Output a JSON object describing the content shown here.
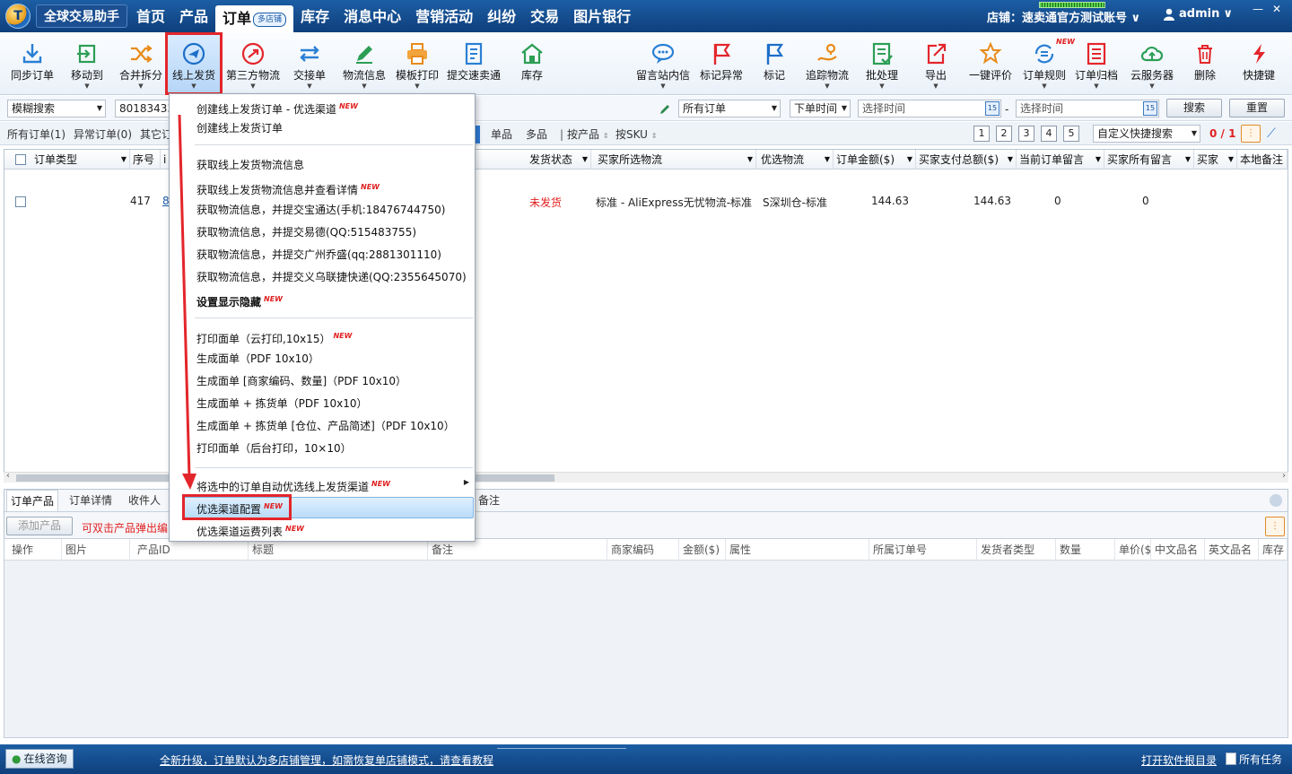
{
  "app": {
    "name": "全球交易助手"
  },
  "main_nav": [
    {
      "label": "首页"
    },
    {
      "label": "产品"
    },
    {
      "label": "订单",
      "badge": "多店铺"
    },
    {
      "label": "库存"
    },
    {
      "label": "消息中心"
    },
    {
      "label": "营销活动"
    },
    {
      "label": "纠纷"
    },
    {
      "label": "交易"
    },
    {
      "label": "图片银行"
    }
  ],
  "store": {
    "label": "店铺：速卖通官方测试账号"
  },
  "user": {
    "name": "admin"
  },
  "toolbar": {
    "items": [
      {
        "label": "同步订单",
        "icon": "download-icon"
      },
      {
        "label": "移动到",
        "icon": "move-icon"
      },
      {
        "label": "合并拆分",
        "icon": "shuffle-icon"
      },
      {
        "label": "线上发货",
        "icon": "plane-icon"
      },
      {
        "label": "第三方物流",
        "icon": "thirdparty-icon"
      },
      {
        "label": "交接单",
        "icon": "swap-icon"
      },
      {
        "label": "物流信息",
        "icon": "pen-icon"
      },
      {
        "label": "模板打印",
        "icon": "printer-icon"
      },
      {
        "label": "提交速卖通",
        "icon": "document-icon"
      },
      {
        "label": "库存",
        "icon": "warehouse-icon"
      },
      {
        "label": "留言站内信",
        "icon": "chat-icon"
      },
      {
        "label": "标记异常",
        "icon": "red-flag-icon"
      },
      {
        "label": "标记",
        "icon": "blue-flag-icon"
      },
      {
        "label": "追踪物流",
        "icon": "tracking-icon"
      },
      {
        "label": "批处理",
        "icon": "batch-icon"
      },
      {
        "label": "导出",
        "icon": "export-icon"
      },
      {
        "label": "一键评价",
        "icon": "review-icon"
      },
      {
        "label": "订单规则",
        "icon": "rules-icon",
        "new": "NEW"
      },
      {
        "label": "订单归档",
        "icon": "archive-icon"
      },
      {
        "label": "云服务器",
        "icon": "cloud-icon"
      },
      {
        "label": "删除",
        "icon": "trash-icon"
      },
      {
        "label": "快捷键",
        "icon": "lightning-icon"
      }
    ]
  },
  "filters": {
    "search_mode": "模糊搜索",
    "search_value": "80183433",
    "order_scope": "所有订单",
    "time_field": "下单时间",
    "start_placeholder": "选择时间",
    "dash": "-",
    "end_placeholder": "选择时间",
    "search_button": "搜索",
    "reset_button": "重置"
  },
  "order_tabs": {
    "all": "所有订单(1)",
    "exception": "异常订单(0)",
    "other": "其它订",
    "single": "单品",
    "multi": "多品",
    "by_product": "按产品",
    "by_sku": "按SKU",
    "pages": [
      "1",
      "2",
      "3",
      "4",
      "5"
    ],
    "quick_search": "自定义快捷搜索",
    "counter": "0 / 1"
  },
  "grid": {
    "columns": [
      "订单类型",
      "序号",
      "i",
      "发货状态",
      "买家所选物流",
      "优选物流",
      "订单金额($)",
      "买家支付总额($)",
      "当前订单留言",
      "买家所有留言",
      "买家",
      "本地备注"
    ],
    "rows": [
      {
        "seq": "417",
        "order_no": "8",
        "status": "未发货",
        "buyer_logistics": "标准 - AliExpress无忧物流-标准",
        "preferred": "S深圳仓-标准",
        "amount": "144.63",
        "paid": "144.63",
        "cur_msg": "0",
        "all_msg": "0"
      }
    ]
  },
  "bottom": {
    "tabs": [
      "订单产品",
      "订单详情",
      "收件人",
      "备注"
    ],
    "add_button": "添加产品",
    "hint": "可双击产品弹出编",
    "columns": [
      "操作",
      "图片",
      "产品ID",
      "标题",
      "备注",
      "商家编码",
      "金额($)",
      "属性",
      "所属订单号",
      "发货者类型",
      "数量",
      "单价($)",
      "中文品名",
      "英文品名",
      "库存"
    ]
  },
  "menu": {
    "items": [
      {
        "label": "创建线上发货订单 - 优选渠道",
        "new": "NEW"
      },
      {
        "label": "创建线上发货订单"
      },
      {
        "label": "获取线上发货物流信息"
      },
      {
        "label": "获取线上发货物流信息并查看详情",
        "new": "NEW"
      },
      {
        "label": "获取物流信息，并提交宝通达(手机:18476744750)"
      },
      {
        "label": "获取物流信息，并提交易德(QQ:515483755)"
      },
      {
        "label": "获取物流信息，并提交广州乔盛(qq:2881301110)"
      },
      {
        "label": "获取物流信息，并提交义乌联捷快递(QQ:2355645070)"
      },
      {
        "label": "设置显示隐藏",
        "new": "NEW"
      },
      {
        "label": "打印面单（云打印,10x15）",
        "new": "NEW"
      },
      {
        "label": "生成面单（PDF 10x10）"
      },
      {
        "label": "生成面单 [商家编码、数量]（PDF 10x10）"
      },
      {
        "label": "生成面单 + 拣货单（PDF 10x10）"
      },
      {
        "label": "生成面单 + 拣货单 [仓位、产品简述]（PDF 10x10）"
      },
      {
        "label": "打印面单（后台打印，10×10）"
      },
      {
        "label": "将选中的订单自动优选线上发货渠道",
        "new": "NEW"
      },
      {
        "label": "优选渠道配置",
        "new": "NEW"
      },
      {
        "label": "优选渠道运费列表",
        "new": "NEW"
      }
    ]
  },
  "statusbar": {
    "consult": "在线咨询",
    "notice": "全新升级，订单默认为多店铺管理，如需恢复单店铺模式，请查看教程",
    "open_log": "打开软件根目录",
    "tasks": "所有任务"
  }
}
